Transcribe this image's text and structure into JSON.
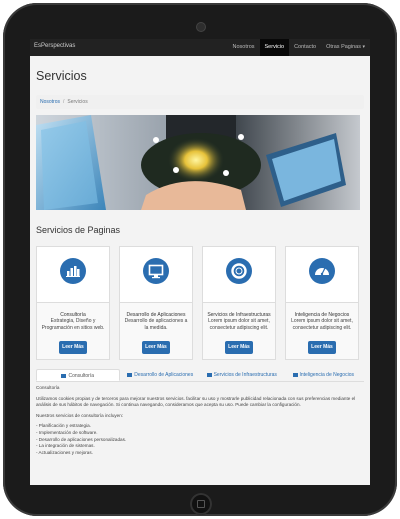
{
  "navbar": {
    "brand": "EsPerspectivas",
    "items": [
      "Nosotros",
      "Servicio",
      "Contacto",
      "Otras Paginas"
    ],
    "active_index": 1
  },
  "page": {
    "title": "Servicios",
    "breadcrumb": {
      "home": "Nosotros",
      "separator": "/",
      "current": "Servicios"
    }
  },
  "section_title": "Servicios de Paginas",
  "cards": [
    {
      "icon": "bar-chart-icon",
      "title": "Consultoría",
      "text": "Estrategia, Diseño y Programación en sitios web.",
      "button": "Leer Más"
    },
    {
      "icon": "monitor-icon",
      "title": "Desarrollo de Aplicaciones",
      "text": "Desarrollo de aplicaciones a la medida.",
      "button": "Leer Más"
    },
    {
      "icon": "lifebuoy-icon",
      "title": "Servicios de Infraestructuras",
      "text": "Lorem ipsum dolor sit amet, consectetur adipiscing elit.",
      "button": "Leer Más"
    },
    {
      "icon": "dashboard-icon",
      "title": "Inteligencia de Negocios",
      "text": "Lorem ipsum dolor sit amet, consectetur adipiscing elit.",
      "button": "Leer Más"
    }
  ],
  "tabs": [
    "Consultoría",
    "Desarrollo de Aplicaciones",
    "Servicios de Infraestructuras",
    "Inteligencia de Negocios"
  ],
  "active_tab": 0,
  "tab_content": {
    "heading": "Consultoría",
    "paragraph": "Utilizamos cookies propias y de terceros para mejorar nuestros servicios. facilitar su uso y mostrarle publicidad relacionada con sus preferencias mediante el análisis de sus hábitos de navegación. Si continua navegando, consideramos que acepta su uso. Puede cambiar la configuración.",
    "list_intro": "Nuestros servicios de consultoría incluyen:",
    "list": [
      "- Planificación y estrategia.",
      "- Implementación de software.",
      "- Desarrollo de aplicaciones personalizadas.",
      "- La integración de sistemas.",
      "- Actualizaciones y mejoras."
    ]
  },
  "colors": {
    "accent": "#2a6db0",
    "navbar": "#222222",
    "device": "#1b1b1b"
  }
}
